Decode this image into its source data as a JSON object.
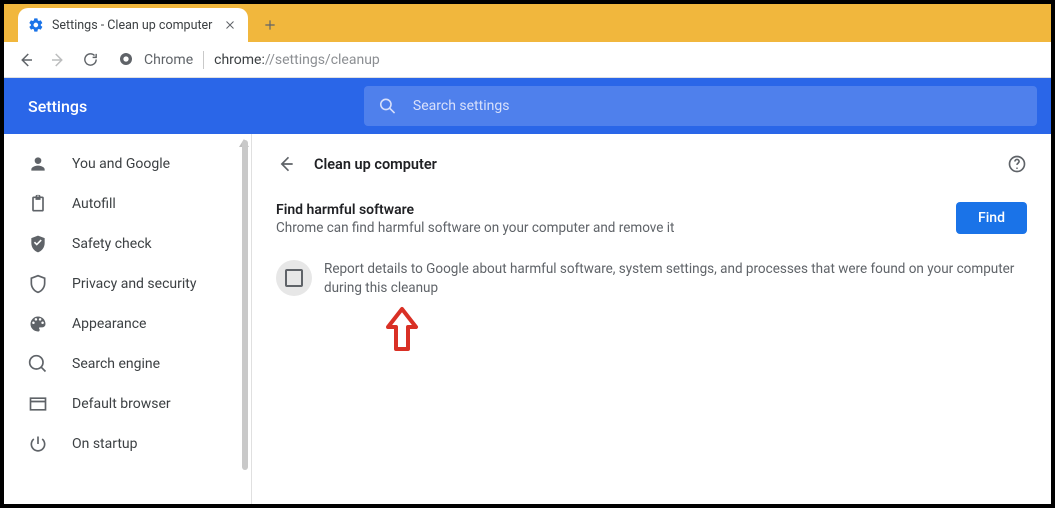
{
  "tab": {
    "title": "Settings - Clean up computer"
  },
  "omnibox": {
    "label": "Chrome",
    "url_prefix": "chrome:",
    "url_rest": "//settings/cleanup"
  },
  "header": {
    "title": "Settings",
    "search_placeholder": "Search settings"
  },
  "sidebar": {
    "items": [
      {
        "label": "You and Google"
      },
      {
        "label": "Autofill"
      },
      {
        "label": "Safety check"
      },
      {
        "label": "Privacy and security"
      },
      {
        "label": "Appearance"
      },
      {
        "label": "Search engine"
      },
      {
        "label": "Default browser"
      },
      {
        "label": "On startup"
      }
    ]
  },
  "page": {
    "title": "Clean up computer",
    "section_title": "Find harmful software",
    "section_desc": "Chrome can find harmful software on your computer and remove it",
    "find_label": "Find",
    "report_text": "Report details to Google about harmful software, system settings, and processes that were found on your computer during this cleanup"
  }
}
